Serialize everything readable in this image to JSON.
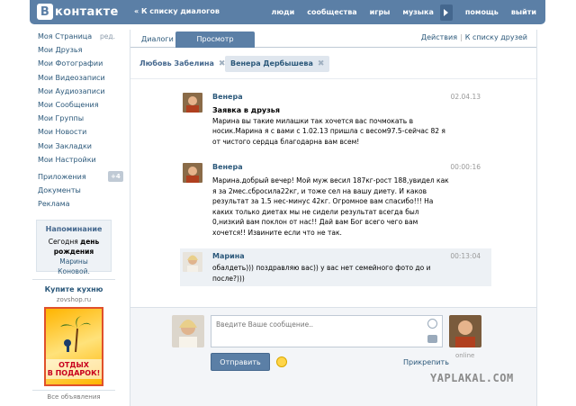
{
  "header": {
    "logo_box": "В",
    "logo_text": "контакте",
    "back_link": "« К списку диалогов",
    "nav": [
      "люди",
      "сообщества",
      "игры",
      "музыка",
      "помощь",
      "выйти"
    ]
  },
  "sidebar": {
    "items": [
      {
        "label": "Моя Страница",
        "extra": "ред."
      },
      {
        "label": "Мои Друзья"
      },
      {
        "label": "Мои Фотографии"
      },
      {
        "label": "Мои Видеозаписи"
      },
      {
        "label": "Мои Аудиозаписи"
      },
      {
        "label": "Мои Сообщения"
      },
      {
        "label": "Мои Группы"
      },
      {
        "label": "Мои Новости"
      },
      {
        "label": "Мои Закладки"
      },
      {
        "label": "Мои Настройки"
      }
    ],
    "items2": [
      {
        "label": "Приложения",
        "badge": "+4"
      },
      {
        "label": "Документы"
      },
      {
        "label": "Реклама"
      }
    ],
    "reminder": {
      "title": "Напоминание",
      "line1_pre": "Сегодня",
      "line1_bold": "день",
      "line2_bold": "рождения",
      "line2_link": "Марины",
      "line3_link": "Коновой."
    },
    "ad": {
      "title": "Купите кухню",
      "domain": "zovshop.ru",
      "banner": "ОТДЫХ\nВ ПОДАРОК!",
      "more": "Все объявления"
    }
  },
  "tabs": {
    "t1": "Диалоги",
    "t2": "Просмотр диалогов",
    "right_actions": "Действия",
    "right_sep": "|",
    "right_link": "К списку друзей"
  },
  "people": {
    "p1": "Любовь Забелина",
    "p2": "Венера Дербышева",
    "close": "✖"
  },
  "messages": [
    {
      "name": "Венера",
      "time": "02.04.13",
      "subject": "Заявка в друзья",
      "text": "Марина вы такие милашки так хочется вас почмокать в носик.Марина я с вами с 1.02.13 пришла с весом97.5-сейчас 82 я от чистого сердца благодарна вам всем!"
    },
    {
      "name": "Венера",
      "time": "00:00:16",
      "text": "Марина.добрый вечер! Мой муж весил 187кг-рост 188,увидел как я за 2мес.сбросила22кг, и тоже сел на вашу диету. И каков результат за 1.5 нес-минус 42кг. Огромное вам спасибо!!! На каких только диетах мы не сидели результат всегда был 0,низкий вам поклон от нас!! Дай вам Бог всего чего вам хочется!! Извините если что не так."
    },
    {
      "name": "Марина",
      "time": "00:13:04",
      "text": "обалдеть))) поздравляю вас)) у вас нет семейного фото до и после?)))"
    }
  ],
  "composer": {
    "placeholder": "Введите Ваше сообщение..",
    "send": "Отправить",
    "attach": "Прикрепить",
    "online": "online"
  },
  "watermark": "YAPLAKAL.COM",
  "colors": {
    "brand": "#5b7fa6",
    "link": "#2b587a",
    "highlight": "#edf1f5"
  }
}
